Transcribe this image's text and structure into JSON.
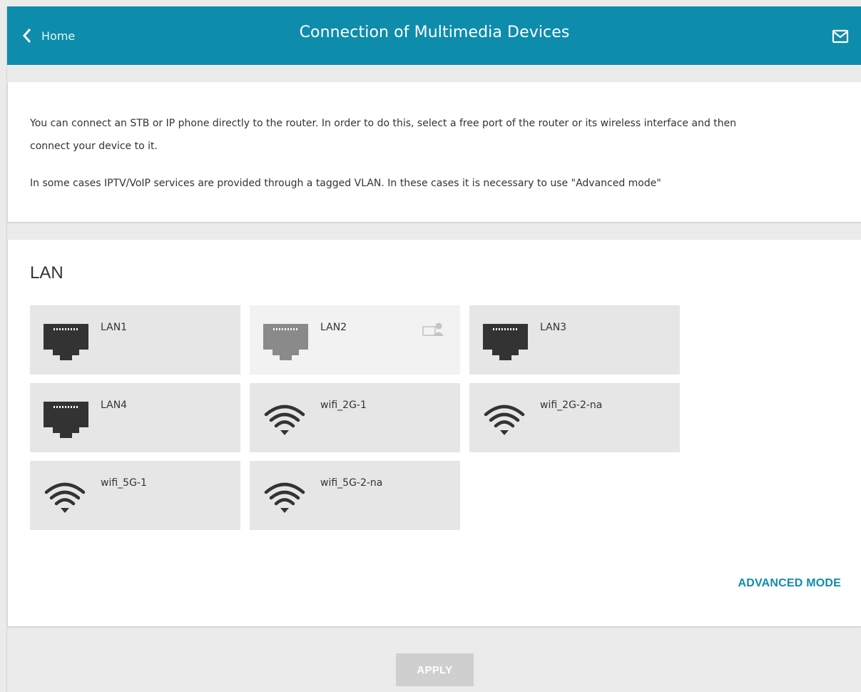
{
  "header": {
    "back_label": "Home",
    "title": "Connection of Multimedia Devices",
    "mail_icon": "envelope-icon"
  },
  "info": {
    "paragraph1_line1": "You can connect an STB or IP phone directly to the router. In order to do this, select a free port of the router or its wireless interface and then",
    "paragraph1_line2": "connect your device to it.",
    "paragraph2": "In some cases IPTV/VoIP services are provided through a tagged VLAN. In these cases it is necessary to use \"Advanced mode\""
  },
  "lan": {
    "title": "LAN",
    "interfaces": [
      {
        "label": "LAN1",
        "icon": "ethernet-port-icon",
        "busy": false
      },
      {
        "label": "LAN2",
        "icon": "ethernet-port-icon",
        "busy": true
      },
      {
        "label": "LAN3",
        "icon": "ethernet-port-icon",
        "busy": false
      },
      {
        "label": "LAN4",
        "icon": "ethernet-port-icon",
        "busy": false
      },
      {
        "label": "wifi_2G-1",
        "icon": "wifi-icon",
        "busy": false
      },
      {
        "label": "wifi_2G-2-na",
        "icon": "wifi-icon",
        "busy": false
      },
      {
        "label": "wifi_5G-1",
        "icon": "wifi-icon",
        "busy": false
      },
      {
        "label": "wifi_5G-2-na",
        "icon": "wifi-icon",
        "busy": false
      }
    ],
    "advanced_label": "ADVANCED MODE"
  },
  "apply_label": "APPLY",
  "colors": {
    "accent": "#0e8cab",
    "tile": "#e6e6e6",
    "tile_busy": "#f2f2f2",
    "port_icon": "#333333",
    "port_icon_busy": "#8a8a8a"
  }
}
